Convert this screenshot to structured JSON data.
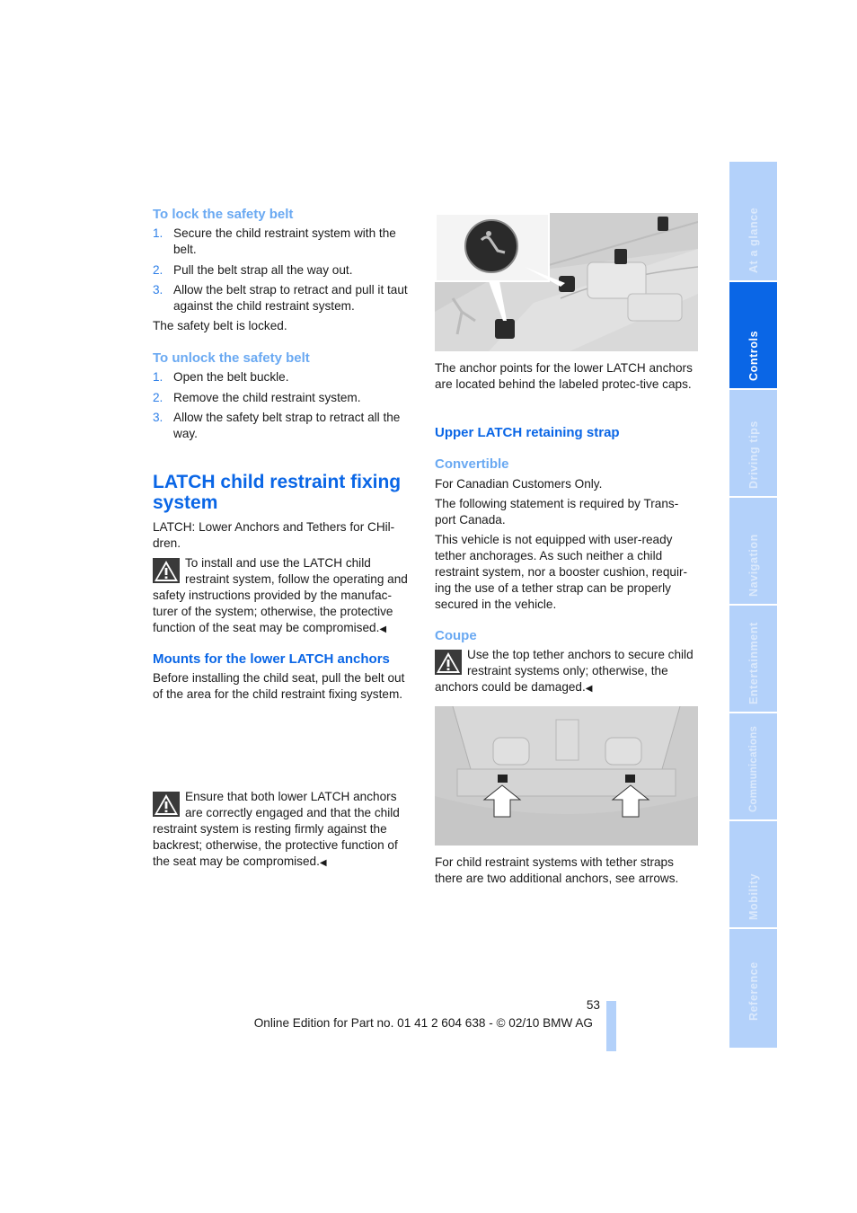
{
  "left_column": {
    "lock_section": {
      "heading": "To lock the safety belt",
      "steps": [
        {
          "num": "1.",
          "text": "Secure the child restraint system with the belt."
        },
        {
          "num": "2.",
          "text": "Pull the belt strap all the way out."
        },
        {
          "num": "3.",
          "text": "Allow the belt strap to retract and pull it taut against the child restraint system."
        }
      ],
      "result": "The safety belt is locked."
    },
    "unlock_section": {
      "heading": "To unlock the safety belt",
      "steps": [
        {
          "num": "1.",
          "text": "Open the belt buckle."
        },
        {
          "num": "2.",
          "text": "Remove the child restraint system."
        },
        {
          "num": "3.",
          "text": "Allow the safety belt strap to retract all the way."
        }
      ]
    },
    "latch_section": {
      "heading": "LATCH child restraint fixing system",
      "intro": "LATCH: Lower Anchors and Tethers for CHil-dren.",
      "warning": "To install and use the LATCH child restraint system, follow the operating and safety instructions provided by the manufac-turer of the system; otherwise, the protective function of the seat may be compromised.",
      "end_mark": "◀"
    },
    "mounts_section": {
      "heading": "Mounts for the lower LATCH anchors",
      "text": "Before installing the child seat, pull the belt out of the area for the child restraint fixing system.",
      "warning": "Ensure that both lower LATCH anchors are correctly engaged and that the child restraint system is resting firmly against the backrest; otherwise, the protective function of the seat may be compromised.",
      "end_mark": "◀"
    }
  },
  "right_column": {
    "image1": {
      "alt": "Rear seat with lower LATCH anchor protective caps and child seat symbol",
      "caption": "The anchor points for the lower LATCH anchors are located behind the labeled protec-tive caps."
    },
    "upper_section": {
      "heading": "Upper LATCH retaining strap",
      "convertible": {
        "heading": "Convertible",
        "paragraphs": [
          "For Canadian Customers Only.",
          "The following statement is required by Trans-port Canada.",
          "This vehicle is not equipped with user-ready tether anchorages. As such neither a child restraint system, nor a booster cushion, requir-ing the use of a tether strap can be properly secured in the vehicle."
        ]
      },
      "coupe": {
        "heading": "Coupe",
        "warning": "Use the top tether anchors to secure child restraint systems only; otherwise, the anchors could be damaged.",
        "end_mark": "◀"
      }
    },
    "image2": {
      "alt": "Rear parcel shelf with two top tether anchors marked by arrows",
      "caption": "For child restraint systems with tether straps there are two additional anchors, see arrows."
    }
  },
  "side_tabs": [
    {
      "label": "At a glance",
      "active": false
    },
    {
      "label": "Controls",
      "active": true
    },
    {
      "label": "Driving tips",
      "active": false
    },
    {
      "label": "Navigation",
      "active": false
    },
    {
      "label": "Entertainment",
      "active": false
    },
    {
      "label": "Communications",
      "active": false
    },
    {
      "label": "Mobility",
      "active": false
    },
    {
      "label": "Reference",
      "active": false
    }
  ],
  "footer": {
    "page_number": "53",
    "edition": "Online Edition for Part no. 01 41 2 604 638 - © 02/10 BMW AG"
  },
  "colors": {
    "heading_blue": "#0a66e6",
    "subheading_light_blue": "#6aa9f2",
    "tab_inactive": "#b3d1fa",
    "tab_active": "#0a66e6"
  }
}
